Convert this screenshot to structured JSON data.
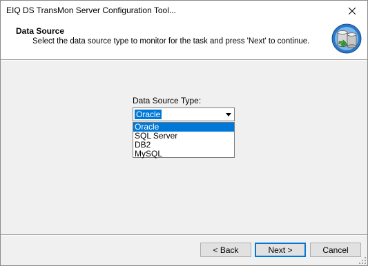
{
  "window": {
    "title": "EIQ DS TransMon Server Configuration Tool..."
  },
  "header": {
    "title": "Data Source",
    "subtitle": "Select the data source type to monitor for the task and press 'Next' to continue.",
    "icon": "database-icon"
  },
  "main": {
    "data_source_label": "Data Source Type:",
    "combo_value": "Oracle",
    "options": [
      {
        "label": "Oracle",
        "selected": true
      },
      {
        "label": "SQL Server",
        "selected": false
      },
      {
        "label": "DB2",
        "selected": false
      },
      {
        "label": "MySQL",
        "selected": false
      }
    ]
  },
  "footer": {
    "back_label": "< Back",
    "next_label": "Next >",
    "cancel_label": "Cancel"
  },
  "colors": {
    "selection": "#0078d7",
    "header_bg": "#ffffff",
    "body_bg": "#f0f0f0"
  }
}
